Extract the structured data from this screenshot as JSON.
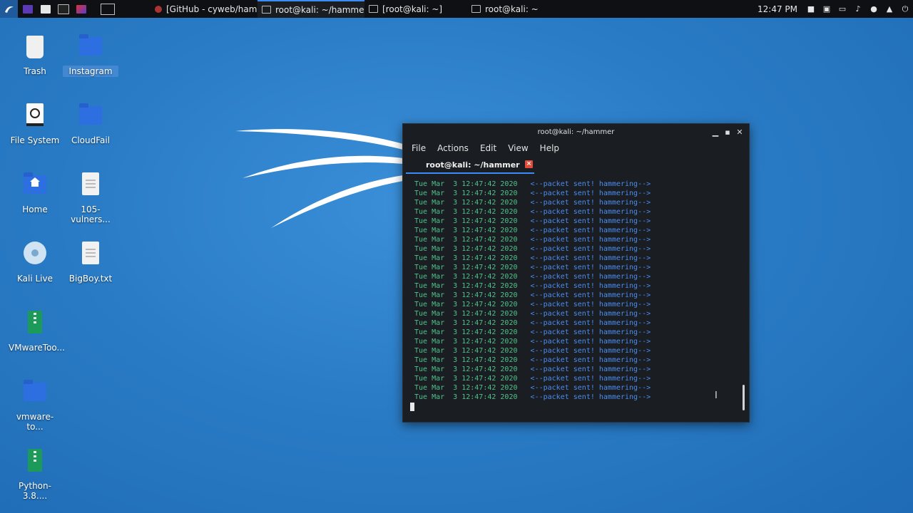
{
  "panel": {
    "tasks": [
      {
        "label": "[GitHub - cyweb/hamme...",
        "kind": "browser"
      },
      {
        "label": "root@kali: ~/hammer",
        "kind": "terminal",
        "active": true
      },
      {
        "label": "[root@kali: ~]",
        "kind": "terminal"
      },
      {
        "label": "root@kali: ~",
        "kind": "terminal"
      }
    ],
    "clock": "12:47 PM"
  },
  "desktop": {
    "icons": [
      {
        "label": "Trash"
      },
      {
        "label": "Instagram"
      },
      {
        "label": "File System"
      },
      {
        "label": "CloudFail"
      },
      {
        "label": "Home"
      },
      {
        "label": "105-vulners..."
      },
      {
        "label": "Kali Live"
      },
      {
        "label": "BigBoy.txt"
      },
      {
        "label": "VMwareToo..."
      },
      {
        "label": "vmware-to..."
      },
      {
        "label": "Python-3.8...."
      }
    ]
  },
  "terminal": {
    "title": "root@kali: ~/hammer",
    "menu": [
      "File",
      "Actions",
      "Edit",
      "View",
      "Help"
    ],
    "tab_label": "root@kali: ~/hammer",
    "timestamp": "Tue Mar  3 12:47:42 2020",
    "message": "<--packet sent! hammering-->",
    "line_count": 24
  },
  "colors": {
    "timestamp": "#4fc28a",
    "message": "#4b8df0",
    "active_tab": "#3b8cf5",
    "close_tab": "#e24c3c"
  }
}
